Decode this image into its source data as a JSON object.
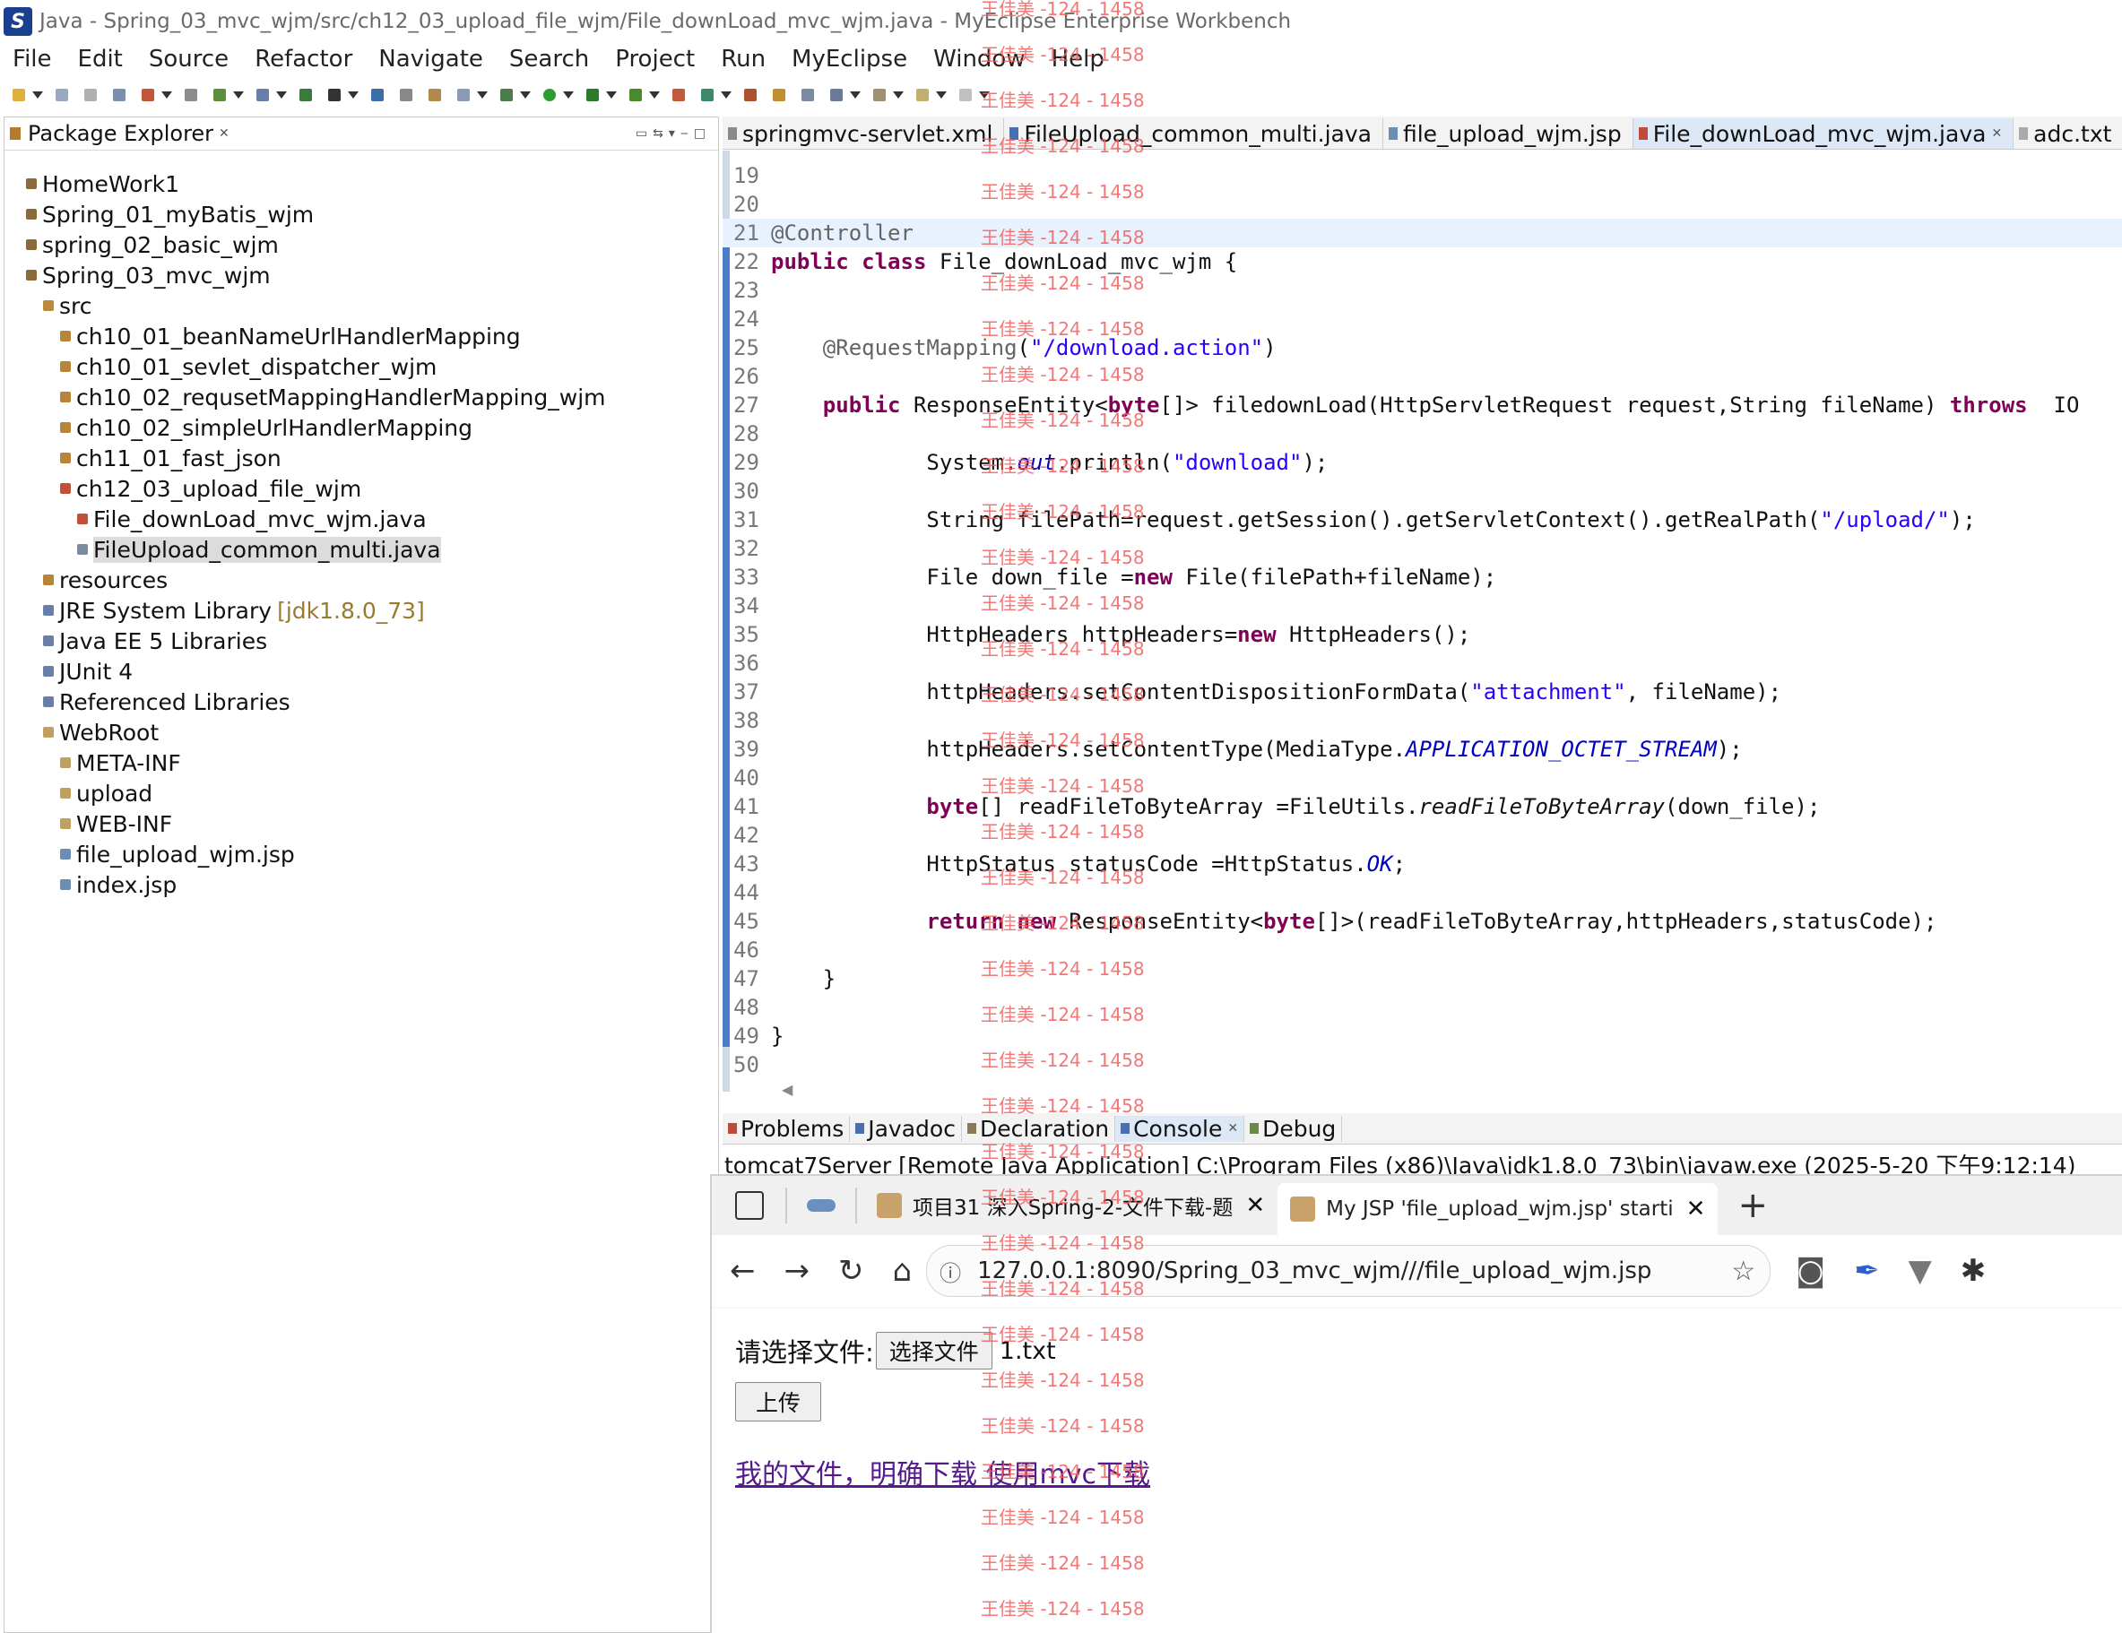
{
  "window": {
    "title": "Java - Spring_03_mvc_wjm/src/ch12_03_upload_file_wjm/File_downLoad_mvc_wjm.java - MyEclipse Enterprise Workbench"
  },
  "menu": [
    "File",
    "Edit",
    "Source",
    "Refactor",
    "Navigate",
    "Search",
    "Project",
    "Run",
    "MyEclipse",
    "Window",
    "Help"
  ],
  "package_explorer": {
    "title": "Package Explorer",
    "items": [
      {
        "label": "HomeWork1"
      },
      {
        "label": "Spring_01_myBatis_wjm"
      },
      {
        "label": "spring_02_basic_wjm"
      },
      {
        "label": "Spring_03_mvc_wjm"
      },
      {
        "label": "src"
      },
      {
        "label": "ch10_01_beanNameUrlHandlerMapping"
      },
      {
        "label": "ch10_01_sevlet_dispatcher_wjm"
      },
      {
        "label": "ch10_02_requsetMappingHandlerMapping_wjm"
      },
      {
        "label": "ch10_02_simpleUrlHandlerMapping"
      },
      {
        "label": "ch11_01_fast_json"
      },
      {
        "label": "ch12_03_upload_file_wjm"
      },
      {
        "label": "File_downLoad_mvc_wjm.java"
      },
      {
        "label": "FileUpload_common_multi.java"
      },
      {
        "label": "resources"
      },
      {
        "label": "JRE System Library",
        "deco": "[jdk1.8.0_73]"
      },
      {
        "label": "Java EE 5 Libraries"
      },
      {
        "label": "JUnit 4"
      },
      {
        "label": "Referenced Libraries"
      },
      {
        "label": "WebRoot"
      },
      {
        "label": "META-INF"
      },
      {
        "label": "upload"
      },
      {
        "label": "WEB-INF"
      },
      {
        "label": "file_upload_wjm.jsp"
      },
      {
        "label": "index.jsp"
      }
    ]
  },
  "editor": {
    "tabs": [
      "springmvc-servlet.xml",
      "FileUpload_common_multi.java",
      "file_upload_wjm.jsp",
      "File_downLoad_mvc_wjm.java",
      "adc.txt"
    ],
    "lines": [
      {
        "n": "19",
        "html": ""
      },
      {
        "n": "20",
        "html": ""
      },
      {
        "n": "21",
        "html": "<span class=\"ann\">@Controller</span>"
      },
      {
        "n": "22",
        "html": "<span class=\"kw\">public</span> <span class=\"kw\">class</span> File_downLoad_mvc_wjm {"
      },
      {
        "n": "23",
        "html": ""
      },
      {
        "n": "24",
        "html": ""
      },
      {
        "n": "25",
        "html": "    <span class=\"ann\">@RequestMapping</span>(<span class=\"str\">\"/download.action\"</span>)"
      },
      {
        "n": "26",
        "html": ""
      },
      {
        "n": "27",
        "html": "    <span class=\"kw\">public</span> ResponseEntity&lt;<span class=\"kw\">byte</span>[]&gt; filedownLoad(HttpServletRequest request,String fileName) <span class=\"kw\">throws</span>  IO"
      },
      {
        "n": "28",
        "html": ""
      },
      {
        "n": "29",
        "html": "            System.<span class=\"ital\">out</span>.println(<span class=\"str\">\"download\"</span>);"
      },
      {
        "n": "30",
        "html": ""
      },
      {
        "n": "31",
        "html": "            String filePath=request.getSession().getServletContext().getRealPath(<span class=\"str\">\"/upload/\"</span>);"
      },
      {
        "n": "32",
        "html": ""
      },
      {
        "n": "33",
        "html": "            File down_file =<span class=\"kw\">new</span> File(filePath+fileName);"
      },
      {
        "n": "34",
        "html": ""
      },
      {
        "n": "35",
        "html": "            HttpHeaders httpHeaders=<span class=\"kw\">new</span> HttpHeaders();"
      },
      {
        "n": "36",
        "html": ""
      },
      {
        "n": "37",
        "html": "            httpHeaders.setContentDispositionFormData(<span class=\"str\">\"attachment\"</span>, fileName);"
      },
      {
        "n": "38",
        "html": ""
      },
      {
        "n": "39",
        "html": "            httpHeaders.setContentType(MediaType.<span class=\"ital\">APPLICATION_OCTET_STREAM</span>);"
      },
      {
        "n": "40",
        "html": ""
      },
      {
        "n": "41",
        "html": "            <span class=\"kw\">byte</span>[] readFileToByteArray =FileUtils.<span class=\"itf\">readFileToByteArray</span>(down_file);"
      },
      {
        "n": "42",
        "html": ""
      },
      {
        "n": "43",
        "html": "            HttpStatus statusCode =HttpStatus.<span class=\"ital\">OK</span>;"
      },
      {
        "n": "44",
        "html": ""
      },
      {
        "n": "45",
        "html": "            <span class=\"kw\">return</span> <span class=\"kw\">new</span> ResponseEntity&lt;<span class=\"kw\">byte</span>[]&gt;(readFileToByteArray,httpHeaders,statusCode);"
      },
      {
        "n": "46",
        "html": ""
      },
      {
        "n": "47",
        "html": "    }"
      },
      {
        "n": "48",
        "html": ""
      },
      {
        "n": "49",
        "html": "}"
      },
      {
        "n": "50",
        "html": ""
      }
    ]
  },
  "console": {
    "tabs": [
      "Problems",
      "Javadoc",
      "Declaration",
      "Console",
      "Debug"
    ],
    "line": "tomcat7Server [Remote Java Application] C:\\Program Files (x86)\\Java\\jdk1.8.0_73\\bin\\javaw.exe (2025-5-20 下午9:12:14)"
  },
  "browser": {
    "tabs": [
      "项目31 深入Spring-2-文件下载-题",
      "My JSP 'file_upload_wjm.jsp' starti"
    ],
    "url": "127.0.0.1:8090/Spring_03_mvc_wjm///file_upload_wjm.jsp",
    "page": {
      "label": "请选择文件:",
      "choose_btn": "选择文件",
      "filename": "1.txt",
      "upload_btn": "上传",
      "link1": "我的文件，明确下载",
      "link2": "使用mvc下载"
    }
  },
  "watermark": "王佳美 -124 - 1458"
}
